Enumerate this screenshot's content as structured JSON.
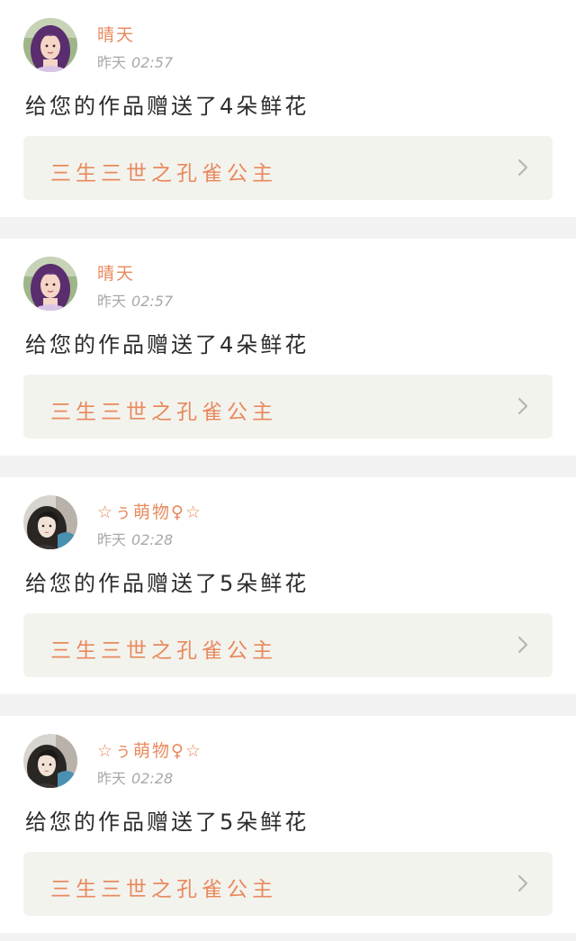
{
  "colors": {
    "accent": "#e8895d",
    "timestamp": "#a8a8a8",
    "message": "#2b2b2b",
    "card_link_bg": "#f3f3ee",
    "separator": "#f2f2f2"
  },
  "notifications": [
    {
      "avatar_icon": "user-avatar-purple-hair",
      "user_name": "晴天",
      "day": "昨天",
      "clock": "02:57",
      "message": "给您的作品赠送了4朵鲜花",
      "work_title": "三生三世之孔雀公主",
      "chevron_icon": "chevron-right-icon"
    },
    {
      "avatar_icon": "user-avatar-purple-hair",
      "user_name": "晴天",
      "day": "昨天",
      "clock": "02:57",
      "message": "给您的作品赠送了4朵鲜花",
      "work_title": "三生三世之孔雀公主",
      "chevron_icon": "chevron-right-icon"
    },
    {
      "avatar_icon": "user-avatar-dark-hair",
      "user_name": "☆ぅ萌物♀☆",
      "day": "昨天",
      "clock": "02:28",
      "message": "给您的作品赠送了5朵鲜花",
      "work_title": "三生三世之孔雀公主",
      "chevron_icon": "chevron-right-icon"
    },
    {
      "avatar_icon": "user-avatar-dark-hair",
      "user_name": "☆ぅ萌物♀☆",
      "day": "昨天",
      "clock": "02:28",
      "message": "给您的作品赠送了5朵鲜花",
      "work_title": "三生三世之孔雀公主",
      "chevron_icon": "chevron-right-icon"
    }
  ]
}
